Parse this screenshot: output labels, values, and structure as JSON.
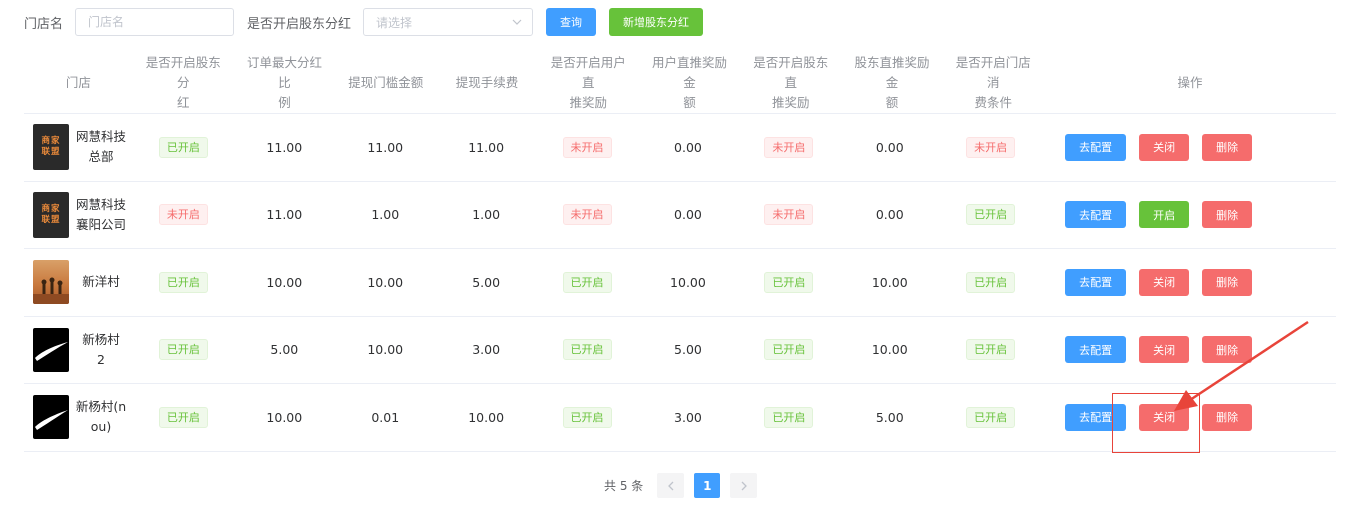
{
  "filters": {
    "store_label": "门店名",
    "store_placeholder": "门店名",
    "dividend_label": "是否开启股东分红",
    "dividend_placeholder": "请选择",
    "query_button": "查询",
    "add_button": "新增股东分红"
  },
  "table": {
    "headers": {
      "store": "门店",
      "dividend_1": "是否开启股东分",
      "dividend_2": "红",
      "max_ratio_1": "订单最大分红比",
      "max_ratio_2": "例",
      "withdraw_threshold": "提现门槛金额",
      "withdraw_fee": "提现手续费",
      "user_reward_1": "是否开启用户直",
      "user_reward_2": "推奖励",
      "user_reward_amount_1": "用户直推奖励金",
      "user_reward_amount_2": "额",
      "holder_reward_1": "是否开启股东直",
      "holder_reward_2": "推奖励",
      "holder_reward_amount_1": "股东直推奖励金",
      "holder_reward_amount_2": "额",
      "consume_cond_1": "是否开启门店消",
      "consume_cond_2": "费条件",
      "actions": "操作"
    },
    "rows": [
      {
        "name_1": "网慧科技",
        "name_2": "总部",
        "avatar": "merchant-league-logo",
        "dividend": "已开启",
        "max_ratio": "11.00",
        "threshold": "11.00",
        "fee": "11.00",
        "user_reward": "未开启",
        "user_amount": "0.00",
        "holder_reward": "未开启",
        "holder_amount": "0.00",
        "consume": "未开启",
        "config": "去配置",
        "toggle": "关闭",
        "delete": "删除"
      },
      {
        "name_1": "网慧科技",
        "name_2": "襄阳公司",
        "avatar": "merchant-league-logo",
        "dividend": "未开启",
        "max_ratio": "11.00",
        "threshold": "1.00",
        "fee": "1.00",
        "user_reward": "未开启",
        "user_amount": "0.00",
        "holder_reward": "未开启",
        "holder_amount": "0.00",
        "consume": "已开启",
        "config": "去配置",
        "toggle": "开启",
        "delete": "删除"
      },
      {
        "name_1": "新洋村",
        "name_2": "",
        "avatar": "desert-photo",
        "dividend": "已开启",
        "max_ratio": "10.00",
        "threshold": "10.00",
        "fee": "5.00",
        "user_reward": "已开启",
        "user_amount": "10.00",
        "holder_reward": "已开启",
        "holder_amount": "10.00",
        "consume": "已开启",
        "config": "去配置",
        "toggle": "关闭",
        "delete": "删除"
      },
      {
        "name_1": "新杨村",
        "name_2": "2",
        "avatar": "swoosh-logo",
        "dividend": "已开启",
        "max_ratio": "5.00",
        "threshold": "10.00",
        "fee": "3.00",
        "user_reward": "已开启",
        "user_amount": "5.00",
        "holder_reward": "已开启",
        "holder_amount": "10.00",
        "consume": "已开启",
        "config": "去配置",
        "toggle": "关闭",
        "delete": "删除"
      },
      {
        "name_1": "新杨村(n",
        "name_2": "ou)",
        "avatar": "swoosh-logo",
        "dividend": "已开启",
        "max_ratio": "10.00",
        "threshold": "0.01",
        "fee": "10.00",
        "user_reward": "已开启",
        "user_amount": "3.00",
        "holder_reward": "已开启",
        "holder_amount": "5.00",
        "consume": "已开启",
        "config": "去配置",
        "toggle": "关闭",
        "delete": "删除"
      }
    ]
  },
  "pagination": {
    "total": "共 5 条",
    "current_page": "1",
    "prev_icon": "chevron-left-icon",
    "next_icon": "chevron-right-icon"
  },
  "colors": {
    "primary": "#409eff",
    "success": "#67c23a",
    "danger": "#f56c6c",
    "annotation": "#e8443a"
  }
}
